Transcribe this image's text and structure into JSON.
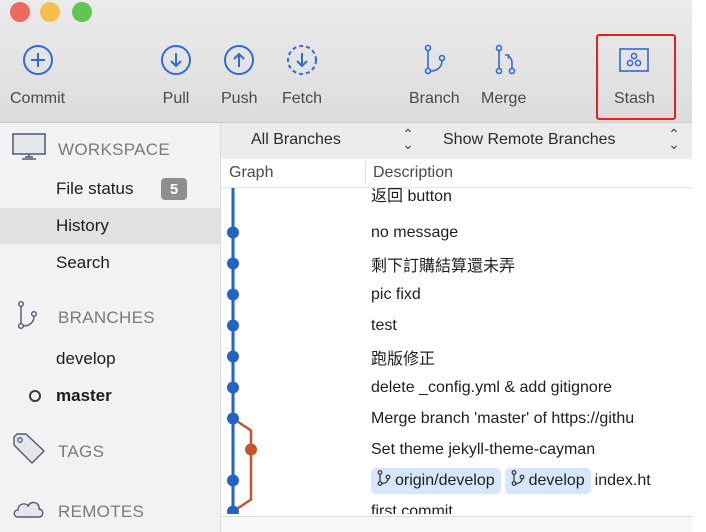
{
  "window": {
    "traffic_lights": [
      {
        "name": "close",
        "color": "#ee6a5f"
      },
      {
        "name": "minimize",
        "color": "#f5bf4f"
      },
      {
        "name": "zoom",
        "color": "#61c454"
      }
    ]
  },
  "toolbar": {
    "accent_color": "#2f6bd6",
    "buttons": [
      {
        "id": "commit",
        "label": "Commit",
        "icon": "plus-circle-icon"
      },
      {
        "id": "pull",
        "label": "Pull",
        "icon": "arrow-down-circle-icon"
      },
      {
        "id": "push",
        "label": "Push",
        "icon": "arrow-up-circle-icon"
      },
      {
        "id": "fetch",
        "label": "Fetch",
        "icon": "dashed-arrow-down-circle-icon"
      },
      {
        "id": "branch",
        "label": "Branch",
        "icon": "branch-icon"
      },
      {
        "id": "merge",
        "label": "Merge",
        "icon": "merge-icon"
      },
      {
        "id": "stash",
        "label": "Stash",
        "icon": "stash-icon",
        "highlighted": true
      }
    ],
    "highlight_color": "#e8201a"
  },
  "sidebar": {
    "workspace": {
      "label": "WORKSPACE",
      "items": [
        {
          "label": "File status",
          "badge": "5"
        },
        {
          "label": "History",
          "selected": true
        },
        {
          "label": "Search"
        }
      ]
    },
    "branches": {
      "label": "BRANCHES",
      "items": [
        {
          "label": "develop",
          "current": false
        },
        {
          "label": "master",
          "current": true
        }
      ]
    },
    "tags": {
      "label": "TAGS"
    },
    "remotes": {
      "label": "REMOTES"
    }
  },
  "main": {
    "filter_branches": "All Branches",
    "filter_remote": "Show Remote Branches",
    "columns": {
      "graph": "Graph",
      "description": "Description"
    },
    "commits": [
      {
        "message": "返回 button",
        "lane": "master",
        "clipped": true
      },
      {
        "message": "no message",
        "lane": "master"
      },
      {
        "message": "剩下訂購結算還未弄",
        "lane": "master"
      },
      {
        "message": "pic fixd",
        "lane": "master"
      },
      {
        "message": "test",
        "lane": "master"
      },
      {
        "message": "跑版修正",
        "lane": "master"
      },
      {
        "message": "delete _config.yml & add gitignore",
        "lane": "master"
      },
      {
        "message": "Merge branch 'master' of https://githu",
        "lane": "master",
        "merge": true
      },
      {
        "message": "Set theme jekyll-theme-cayman",
        "lane": "develop"
      },
      {
        "message": "index.ht",
        "lane": "master",
        "tags": [
          "origin/develop",
          "develop"
        ]
      },
      {
        "message": "first commit",
        "lane": "master"
      }
    ],
    "graph_colors": {
      "master": "#2463c6",
      "develop": "#c8532a"
    }
  }
}
